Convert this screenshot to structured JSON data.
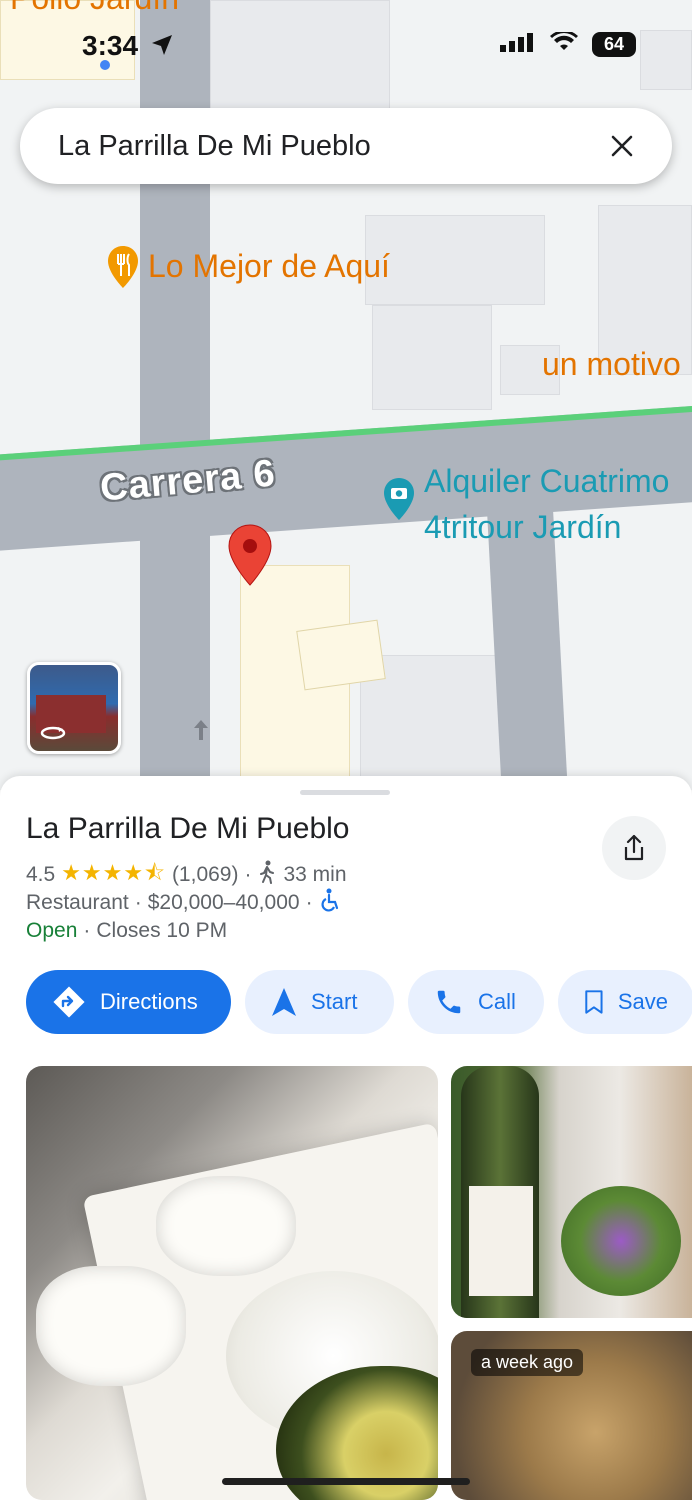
{
  "status_bar": {
    "time": "3:34",
    "battery": "64"
  },
  "search": {
    "query": "La Parrilla De Mi Pueblo"
  },
  "map": {
    "poi_1": "Lo Mejor de Aquí",
    "poi_2": "un motivo",
    "poi_3_line1": "Alquiler Cuatrimo",
    "poi_3_line2": "4tritour Jardín",
    "top_partial": "Pollo Jardín",
    "road": "Carrera 6",
    "colors": {
      "food_poi": "#f29900",
      "photo_poi": "#1a9bb3",
      "pin": "#ea4335",
      "road_highlight": "#34a853"
    }
  },
  "place": {
    "name": "La Parrilla De Mi Pueblo",
    "rating": "4.5",
    "stars": "★★★★⯪",
    "review_count": "(1,069)",
    "walk_time": "33 min",
    "category": "Restaurant",
    "price_range": "$20,000–40,000",
    "open_status": "Open",
    "closes": "Closes 10 PM",
    "separator": "·"
  },
  "actions": {
    "directions": "Directions",
    "start": "Start",
    "call": "Call",
    "save": "Save"
  },
  "photos": {
    "badge": "a week ago"
  }
}
